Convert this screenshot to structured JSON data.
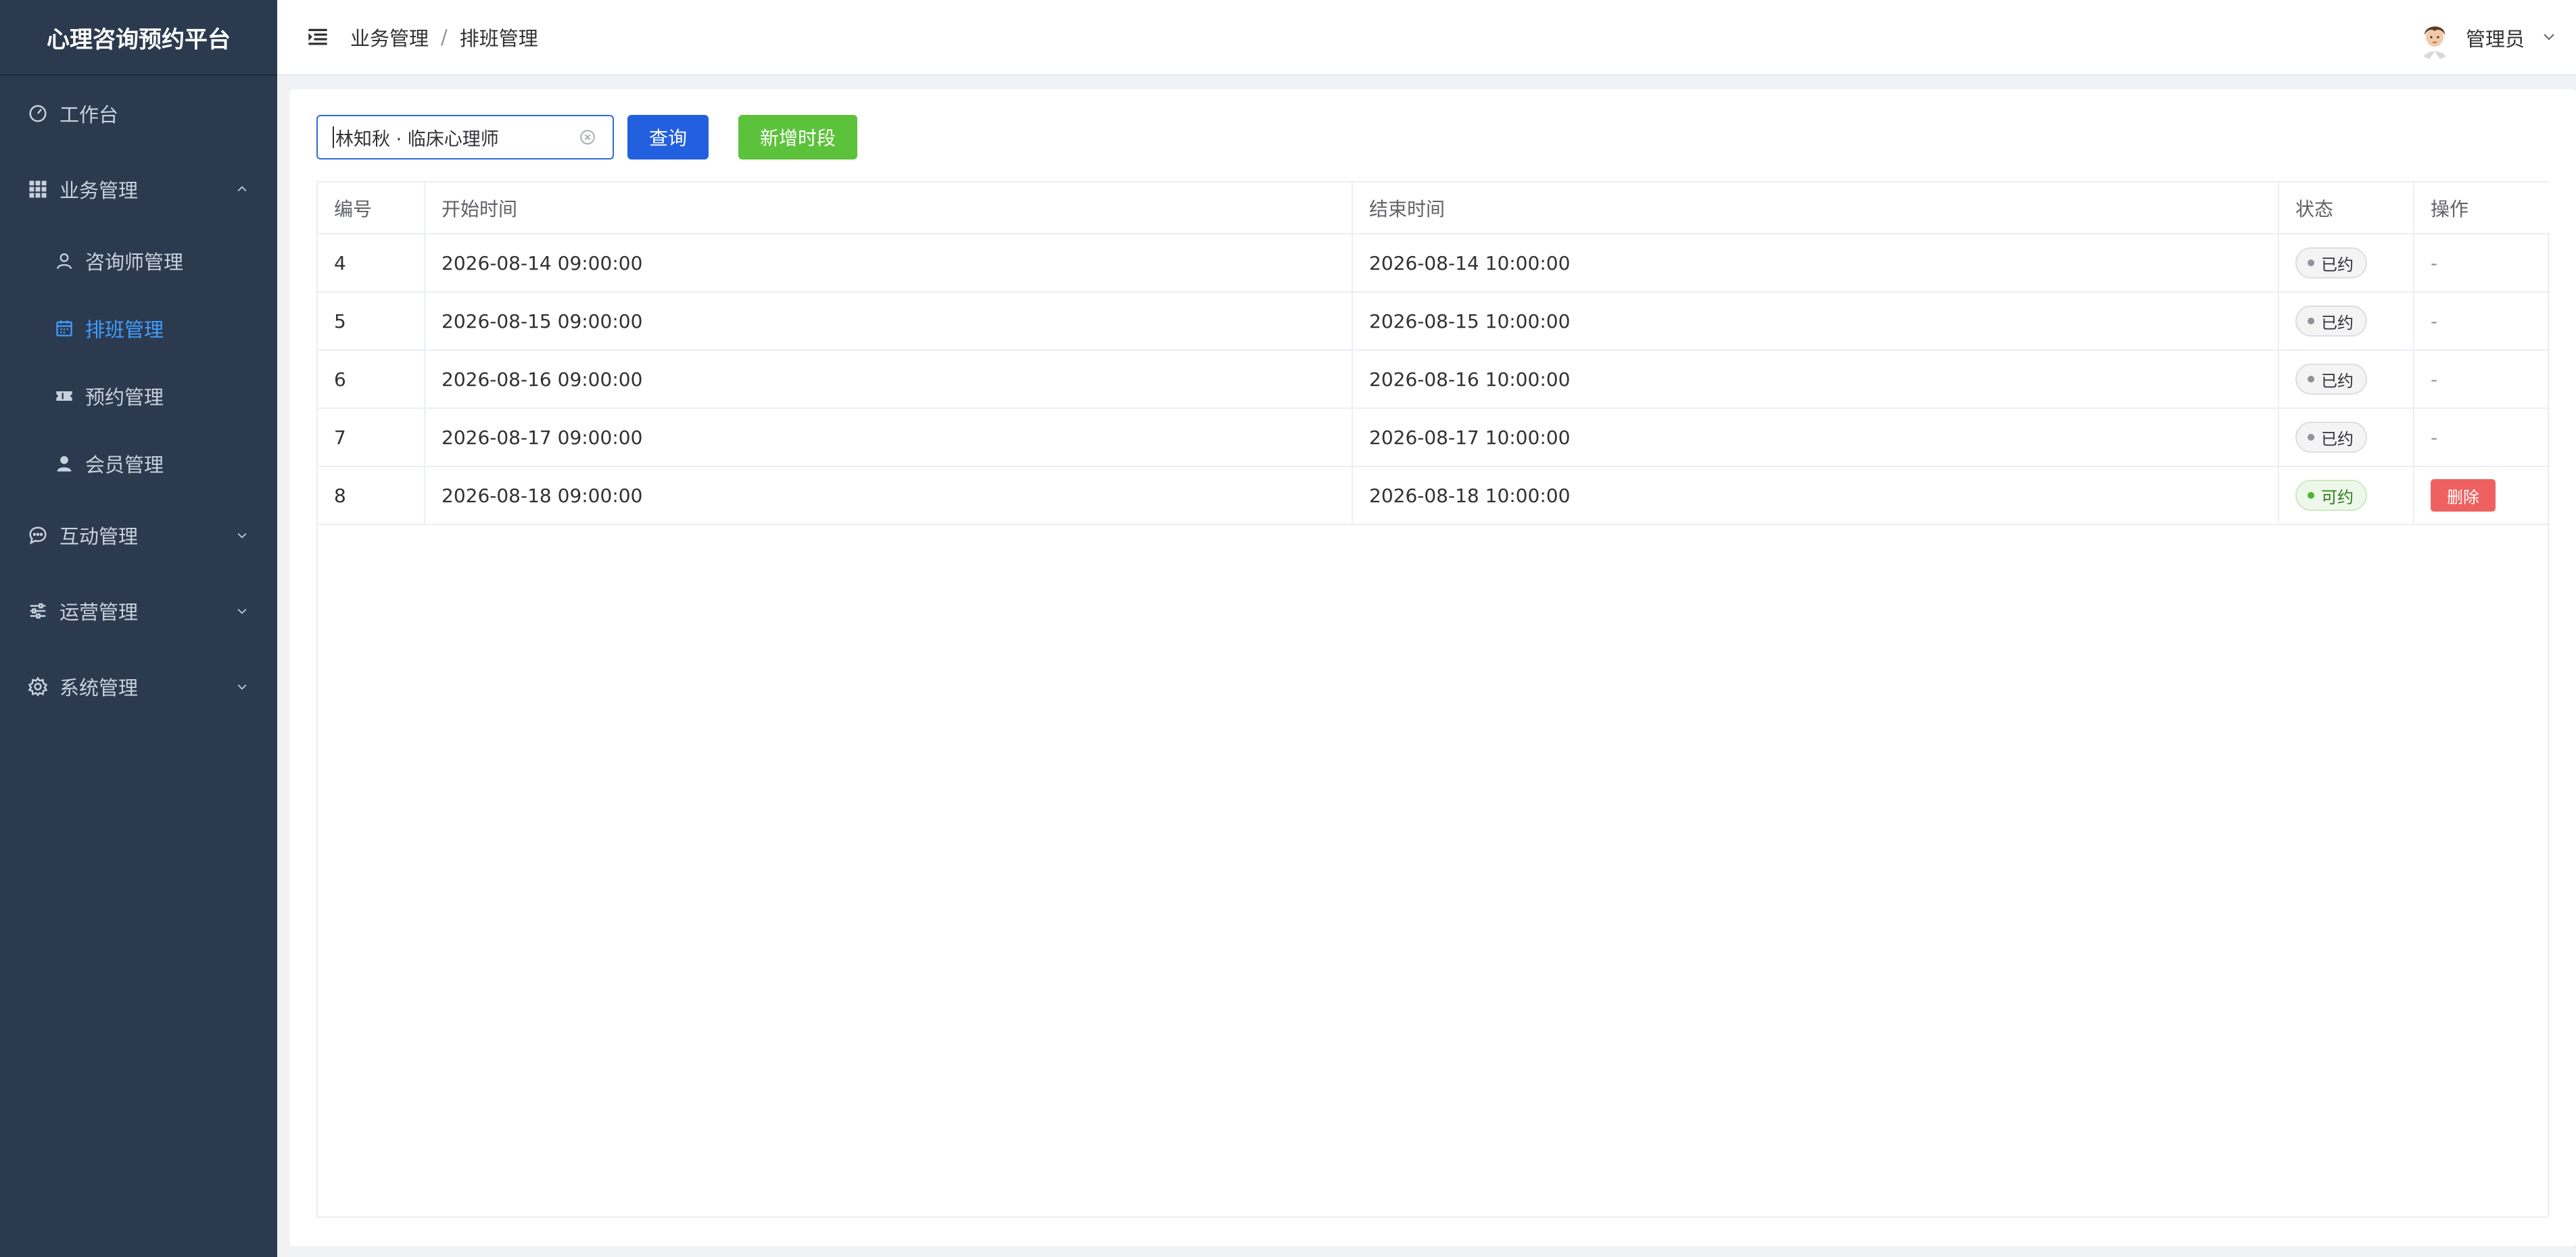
{
  "app": {
    "title": "心理咨询预约平台"
  },
  "sidebar": {
    "items": [
      {
        "label": "工作台",
        "icon": "gauge-icon"
      },
      {
        "label": "业务管理",
        "icon": "grid-icon",
        "expanded": true,
        "children": [
          {
            "label": "咨询师管理",
            "icon": "person-outline-icon"
          },
          {
            "label": "排班管理",
            "icon": "calendar-icon",
            "active": true
          },
          {
            "label": "预约管理",
            "icon": "ticket-icon"
          },
          {
            "label": "会员管理",
            "icon": "person-solid-icon"
          }
        ]
      },
      {
        "label": "互动管理",
        "icon": "chat-icon",
        "expanded": false
      },
      {
        "label": "运营管理",
        "icon": "sliders-icon",
        "expanded": false
      },
      {
        "label": "系统管理",
        "icon": "gear-icon",
        "expanded": false
      }
    ]
  },
  "header": {
    "breadcrumb": [
      "业务管理",
      "排班管理"
    ],
    "separator": "/",
    "user_name": "管理员"
  },
  "toolbar": {
    "search_value": "林知秋 · 临床心理师",
    "query_label": "查询",
    "add_label": "新增时段"
  },
  "table": {
    "columns": [
      "编号",
      "开始时间",
      "结束时间",
      "状态",
      "操作"
    ],
    "rows": [
      {
        "id": "4",
        "start": "2026-08-14 09:00:00",
        "end": "2026-08-14 10:00:00",
        "status": "已约",
        "status_type": "booked",
        "op": "-"
      },
      {
        "id": "5",
        "start": "2026-08-15 09:00:00",
        "end": "2026-08-15 10:00:00",
        "status": "已约",
        "status_type": "booked",
        "op": "-"
      },
      {
        "id": "6",
        "start": "2026-08-16 09:00:00",
        "end": "2026-08-16 10:00:00",
        "status": "已约",
        "status_type": "booked",
        "op": "-"
      },
      {
        "id": "7",
        "start": "2026-08-17 09:00:00",
        "end": "2026-08-17 10:00:00",
        "status": "已约",
        "status_type": "booked",
        "op": "-"
      },
      {
        "id": "8",
        "start": "2026-08-18 09:00:00",
        "end": "2026-08-18 10:00:00",
        "status": "可约",
        "status_type": "available",
        "op": "删除"
      }
    ]
  },
  "colors": {
    "sidebar_bg": "#2b3a4f",
    "active_menu": "#409eff",
    "query_button": "#2260e0",
    "add_button": "#5cc23b",
    "delete_button": "#ef6161"
  }
}
